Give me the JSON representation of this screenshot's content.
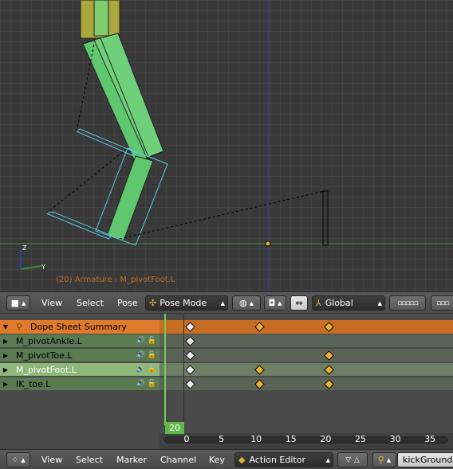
{
  "viewport": {
    "status_text": "(20) Armature : M_pivotFoot.L"
  },
  "vp_header": {
    "menus": [
      "View",
      "Select",
      "Pose"
    ],
    "mode": "Pose Mode",
    "orientation": "Global"
  },
  "dopesheet": {
    "channels": [
      {
        "label": "Dope Sheet Summary",
        "type": "summary",
        "keys": [
          {
            "frame": 0,
            "color": "white"
          },
          {
            "frame": 10,
            "color": "orange"
          },
          {
            "frame": 20,
            "color": "orange"
          }
        ]
      },
      {
        "label": "M_pivotAnkle.L",
        "type": "row",
        "keys": [
          {
            "frame": 0,
            "color": "white"
          }
        ]
      },
      {
        "label": "M_pivotToe.L",
        "type": "row",
        "keys": [
          {
            "frame": 0,
            "color": "white"
          },
          {
            "frame": 20,
            "color": "orange"
          }
        ]
      },
      {
        "label": "M_pivotFoot.L",
        "type": "row",
        "selected": true,
        "keys": [
          {
            "frame": 0,
            "color": "white"
          },
          {
            "frame": 10,
            "color": "orange"
          },
          {
            "frame": 20,
            "color": "orange"
          }
        ]
      },
      {
        "label": "IK_toe.L",
        "type": "row",
        "keys": [
          {
            "frame": 0,
            "color": "white"
          },
          {
            "frame": 10,
            "color": "orange"
          },
          {
            "frame": 20,
            "color": "orange"
          }
        ]
      }
    ],
    "ruler_ticks": [
      "0",
      "5",
      "10",
      "15",
      "20",
      "25",
      "30",
      "35"
    ],
    "current_frame": "20"
  },
  "ds_header": {
    "menus": [
      "View",
      "Select",
      "Marker",
      "Channel",
      "Key"
    ],
    "mode": "Action Editor",
    "action_name": "kickGround"
  },
  "colors": {
    "summary": "#e07b2b",
    "keyframe_selected": "#e8b035",
    "playhead": "#6fd04f"
  }
}
